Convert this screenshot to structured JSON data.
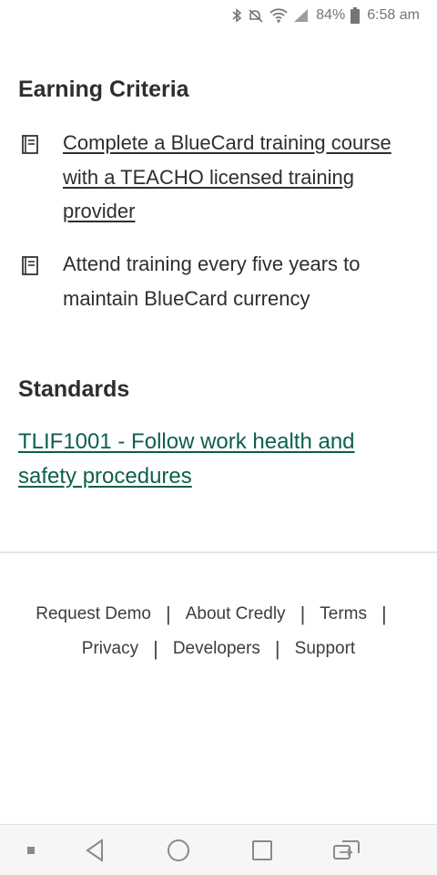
{
  "status_bar": {
    "icons": [
      "bluetooth-icon",
      "mute-icon",
      "wifi-icon",
      "signal-icon",
      "battery-icon"
    ],
    "battery": "84%",
    "time": "6:58 am"
  },
  "earning_criteria": {
    "title": "Earning Criteria",
    "items": [
      {
        "icon": "book-icon",
        "text": "Complete a BlueCard training course with a TEACHO licensed training provider",
        "is_link": true
      },
      {
        "icon": "book-icon",
        "text": "Attend training every five years to maintain BlueCard currency",
        "is_link": false
      }
    ]
  },
  "standards": {
    "title": "Standards",
    "link_text": "TLIF1001 - Follow work health and safety procedures"
  },
  "footer": {
    "row1": [
      "Request Demo",
      "About Credly",
      "Terms"
    ],
    "row2": [
      "Privacy",
      "Developers",
      "Support"
    ],
    "separator": "|"
  },
  "nav_bar": {
    "icons": [
      "dot-icon",
      "back-icon",
      "home-icon",
      "recents-icon",
      "switch-app-icon"
    ]
  },
  "colors": {
    "link": "#0d5f4e",
    "text": "#2e2e2e",
    "status_text": "#757575"
  }
}
